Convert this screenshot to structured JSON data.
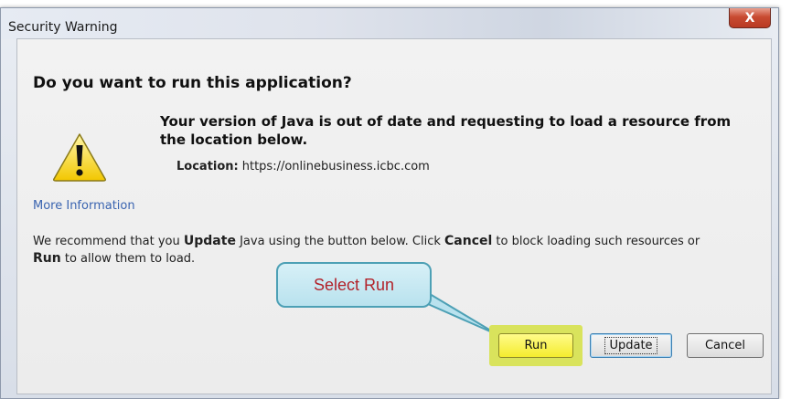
{
  "window": {
    "title": "Security Warning",
    "close_label": "X"
  },
  "dialog": {
    "heading": "Do you want to run this application?",
    "icon": "warning-triangle-icon",
    "message": "Your version of Java is out of date and requesting to load a resource from the location below.",
    "location_label": "Location:",
    "location_value": "https://onlinebusiness.icbc.com",
    "more_info": "More Information",
    "recommend": {
      "part1": "We recommend that you ",
      "update_word": "Update",
      "part2": " Java using the button below. Click ",
      "cancel_word": "Cancel",
      "part3": " to block loading such resources or ",
      "run_word": "Run",
      "part4": " to allow them to load."
    }
  },
  "buttons": {
    "run": "Run",
    "update": "Update",
    "cancel": "Cancel"
  },
  "annotation": {
    "callout_text": "Select Run",
    "callout_text_color": "#b2222a",
    "highlight_color": "#d9e35c"
  }
}
